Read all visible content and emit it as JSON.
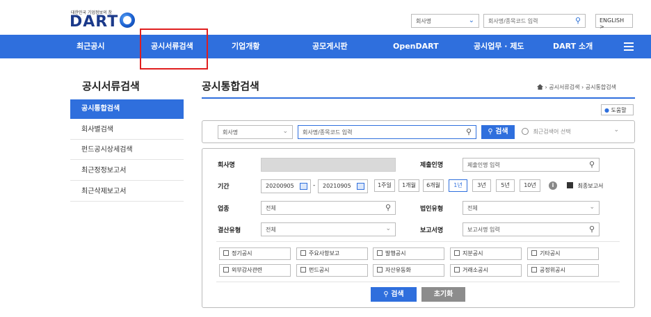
{
  "header": {
    "logo_small": "대한민국 기업정보의 창",
    "logo": "DART",
    "search_select": "회사명",
    "search_placeholder": "회사명/종목코드 입력",
    "english_label": "ENGLISH >"
  },
  "nav": {
    "items": [
      "최근공시",
      "공시서류검색",
      "기업개황",
      "공모게시판",
      "OpenDART",
      "공시업무 · 제도",
      "DART 소개"
    ]
  },
  "sidebar": {
    "title": "공시서류검색",
    "items": [
      "공시통합검색",
      "회사별검색",
      "펀드공시상세검색",
      "최근정정보고서",
      "최근삭제보고서"
    ],
    "active_index": 0
  },
  "main": {
    "title": "공시통합검색",
    "breadcrumb": [
      "공시서류검색",
      "공시통합검색"
    ],
    "help_label": "도움말",
    "search": {
      "select": "회사명",
      "placeholder": "회사명/종목코드 입력",
      "button": "검색",
      "recent_placeholder": "최근검색어 선택"
    },
    "detail": {
      "company_label": "회사명",
      "submitter_label": "제출인명",
      "submitter_placeholder": "제출인명 입력",
      "period_label": "기간",
      "date_from": "20200905",
      "date_sep": "-",
      "date_to": "20210905",
      "periods": [
        "1주일",
        "1개월",
        "6개월",
        "1년",
        "3년",
        "5년",
        "10년"
      ],
      "selected_period": "1년",
      "final_report_label": "최종보고서",
      "industry_label": "업종",
      "industry_value": "전체",
      "corp_type_label": "법인유형",
      "corp_type_value": "전체",
      "settle_label": "결산유형",
      "settle_value": "전체",
      "report_name_label": "보고서명",
      "report_name_placeholder": "보고서명 입력",
      "types_row1": [
        "정기공시",
        "주요사항보고",
        "발행공시",
        "지분공시",
        "기타공시"
      ],
      "types_row2": [
        "외부감사관련",
        "펀드공시",
        "자산유동화",
        "거래소공시",
        "공정위공시"
      ]
    },
    "search_button": "검색",
    "reset_button": "초기화"
  },
  "colors": {
    "brand_blue": "#2f6fdd",
    "highlight": "#e01e1e"
  }
}
